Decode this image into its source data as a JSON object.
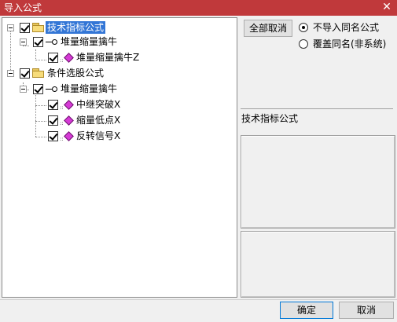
{
  "window": {
    "title": "导入公式",
    "close": "✕"
  },
  "tree": {
    "nodes": [
      {
        "label": "技术指标公式",
        "checked": true,
        "selected": true,
        "icon": "folder-icon"
      },
      {
        "label": "堆量缩量擒牛",
        "checked": true,
        "icon": "key-icon"
      },
      {
        "label": "堆量缩量擒牛Z",
        "checked": true,
        "icon": "formula-diamond-icon"
      },
      {
        "label": "条件选股公式",
        "checked": true,
        "icon": "folder-icon"
      },
      {
        "label": "堆量缩量擒牛",
        "checked": true,
        "icon": "key-icon"
      },
      {
        "label": "中继突破X",
        "checked": true,
        "icon": "formula-diamond-icon"
      },
      {
        "label": "缩量低点X",
        "checked": true,
        "icon": "formula-diamond-icon"
      },
      {
        "label": "反转信号X",
        "checked": true,
        "icon": "formula-diamond-icon"
      }
    ]
  },
  "actions": {
    "deselect_all": "全部取消",
    "ok": "确定",
    "cancel": "取消"
  },
  "options": {
    "no_import": {
      "label": "不导入同名公式",
      "selected": true
    },
    "overwrite": {
      "label": "覆盖同名(非系统)",
      "selected": false
    }
  },
  "info": {
    "caption": "技术指标公式"
  }
}
